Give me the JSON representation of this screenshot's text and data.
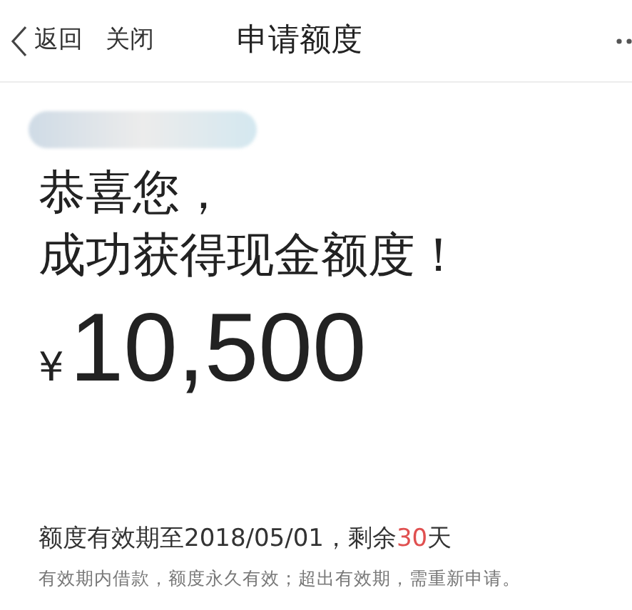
{
  "header": {
    "back": "返回",
    "close": "关闭",
    "title": "申请额度"
  },
  "result": {
    "line_1": "恭喜您，",
    "line_2": "成功获得现金额度！",
    "currency": "¥",
    "amount": "10,500"
  },
  "validity": {
    "prefix": "额度有效期至2018/05/01，剩余",
    "days": "30",
    "suffix": "天",
    "note": "有效期内借款，额度永久有效；超出有效期，需重新申请。"
  }
}
